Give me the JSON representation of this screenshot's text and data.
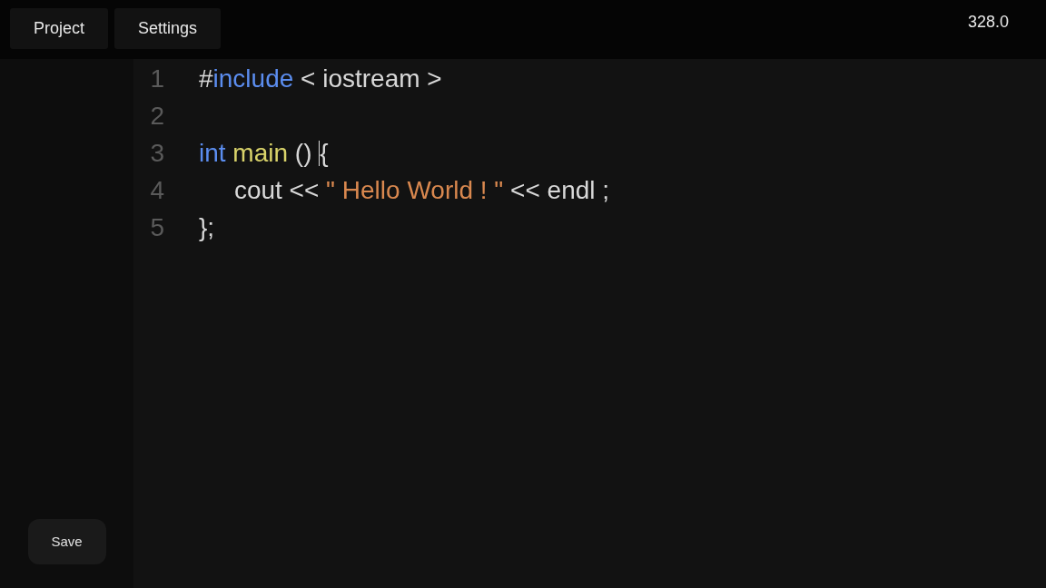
{
  "menu": [
    {
      "label": "Project"
    },
    {
      "label": "Settings"
    }
  ],
  "counter": "328.0",
  "editor": {
    "lines": [
      {
        "number": "1",
        "tokens": [
          {
            "kind": "plain",
            "text": "#"
          },
          {
            "kind": "keyword",
            "text": "include"
          },
          {
            "kind": "plain",
            "text": " < iostream >"
          }
        ]
      },
      {
        "number": "2"
      },
      {
        "number": "3",
        "tokens": [
          {
            "kind": "keyword",
            "text": "int "
          },
          {
            "kind": "function",
            "text": "main"
          },
          {
            "kind": "plain",
            "text": " () "
          },
          {
            "kind": "caret"
          },
          {
            "kind": "plain",
            "text": "{"
          }
        ]
      },
      {
        "number": "4",
        "tokens": [
          {
            "kind": "plain",
            "text": "     cout << "
          },
          {
            "kind": "string",
            "text": "\" Hello World ! \""
          },
          {
            "kind": "plain",
            "text": " << endl ;"
          }
        ]
      },
      {
        "number": "5",
        "tokens": [
          {
            "kind": "plain",
            "text": "};"
          }
        ]
      }
    ]
  },
  "save_button": "Save"
}
